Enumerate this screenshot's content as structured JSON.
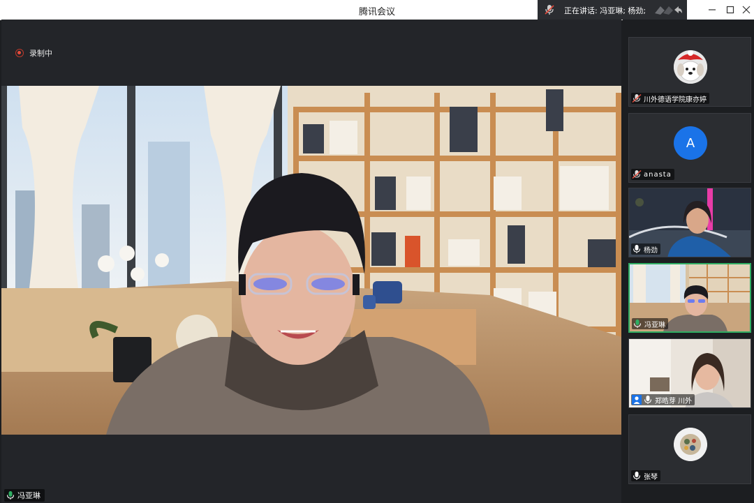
{
  "window": {
    "title": "腾讯会议"
  },
  "speaking": {
    "label": "正在讲话: 冯亚琳; 杨劲;"
  },
  "recording": {
    "label": "录制中"
  },
  "main_video": {
    "name": "冯亚琳"
  },
  "participants": [
    {
      "name": "川外德语学院康亦婷",
      "kind": "avatar-dog",
      "mic": "muted"
    },
    {
      "name": "anasta",
      "kind": "avatar-letter",
      "letter": "A",
      "mic": "muted"
    },
    {
      "name": "杨劲",
      "kind": "video",
      "mic": "on"
    },
    {
      "name": "冯亚琳",
      "kind": "video",
      "mic": "on",
      "active": true
    },
    {
      "name": "郑晧芽 川外",
      "kind": "video",
      "mic": "on",
      "host": true
    },
    {
      "name": "张琴",
      "kind": "avatar-round",
      "mic": "on"
    }
  ],
  "colors": {
    "active_border": "#2fae63",
    "avatar_blue": "#1a73e8",
    "recording_red": "#e74c3c"
  }
}
